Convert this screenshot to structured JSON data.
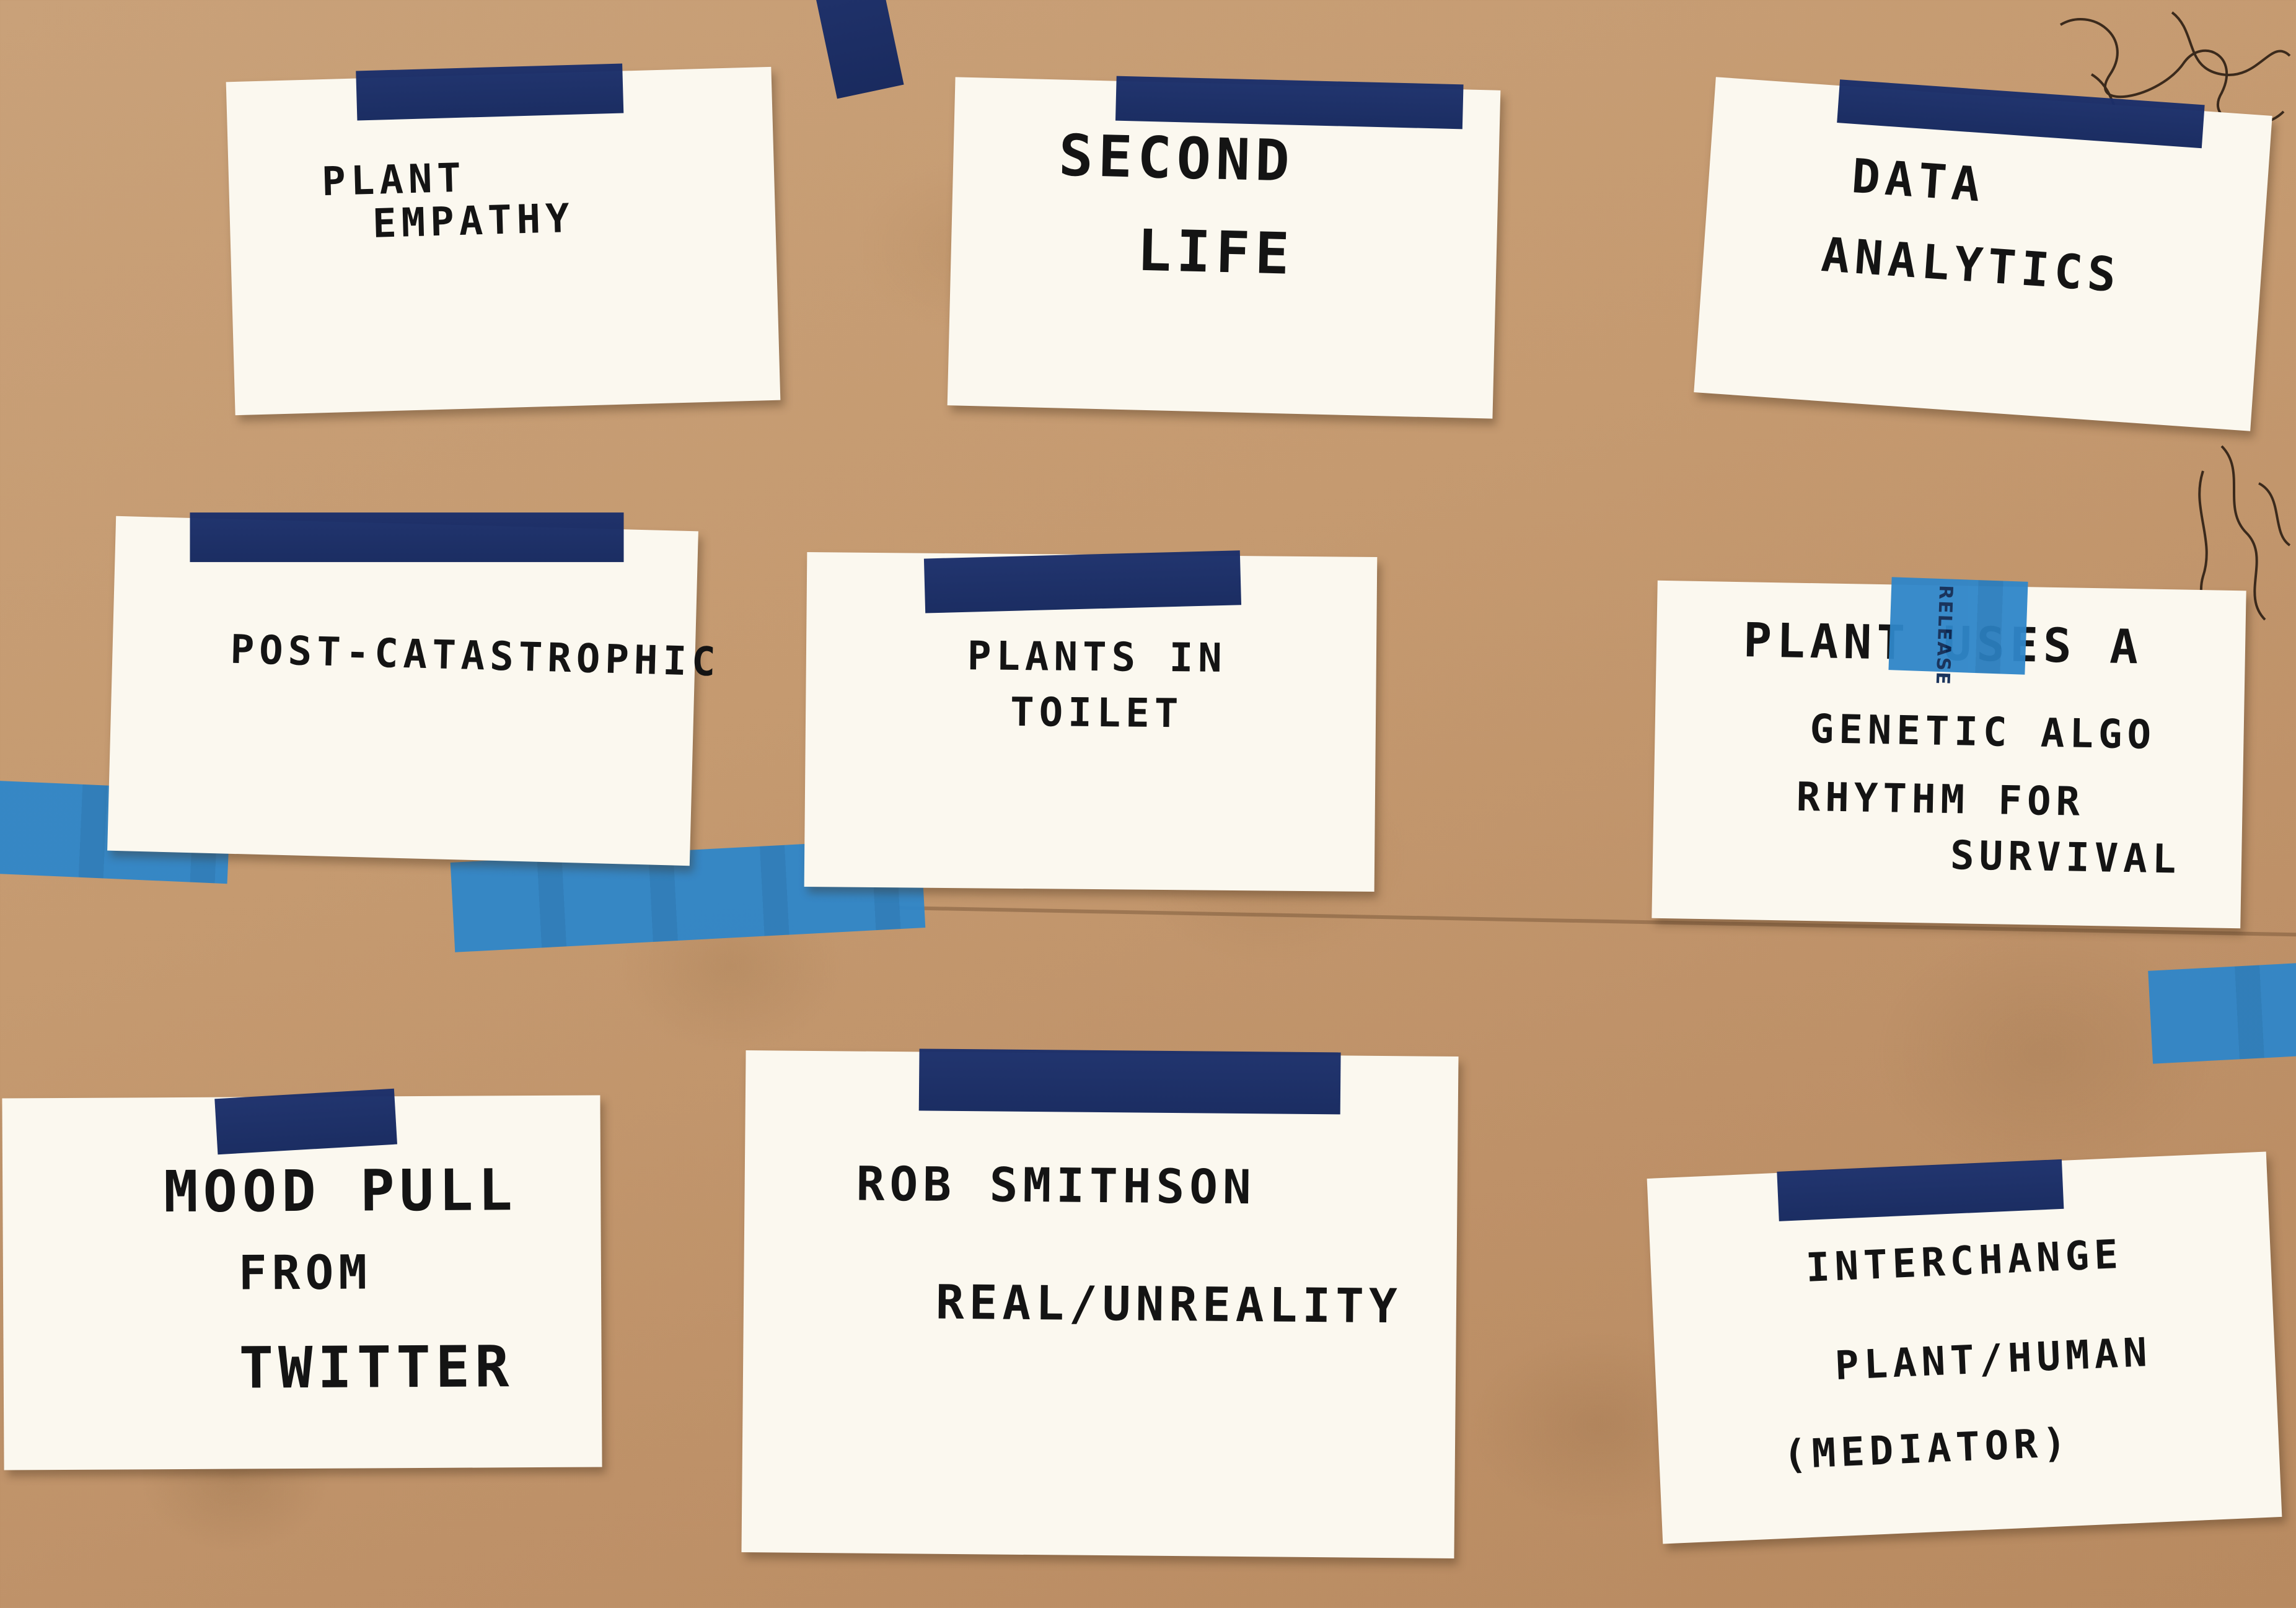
{
  "cards": [
    {
      "lines": [
        "PLANT",
        "EMPATHY"
      ]
    },
    {
      "lines": [
        "SECOND",
        "LIFE"
      ]
    },
    {
      "lines": [
        "DATA",
        "ANALYTICS"
      ]
    },
    {
      "lines": [
        "POST-CATASTROPHIC"
      ]
    },
    {
      "lines": [
        "PLANTS IN",
        "TOILET"
      ]
    },
    {
      "lines": [
        "PLANT USES A",
        "GENETIC ALGO",
        "RHYTHM FOR",
        "SURVIVAL"
      ]
    },
    {
      "lines": [
        "MOOD PULL",
        "FROM",
        "TWITTER"
      ]
    },
    {
      "lines": [
        "ROB SMITHSON",
        "REAL/UNREALITY"
      ]
    },
    {
      "lines": [
        "INTERCHANGE",
        "PLANT/HUMAN",
        "(MEDIATOR)"
      ]
    }
  ],
  "tape_text": "RELEASE",
  "colors": {
    "board": "#c59a70",
    "card": "#fbf8ef",
    "dark_tape": "#1b2f6b",
    "blue_tape": "#2f86c9",
    "ink": "#141414"
  }
}
